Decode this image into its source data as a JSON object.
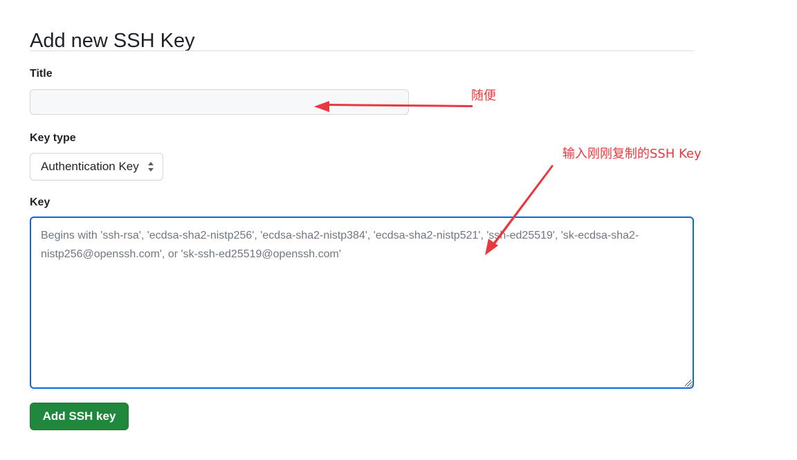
{
  "page": {
    "title": "Add new SSH Key"
  },
  "form": {
    "title_label": "Title",
    "title_value": "",
    "key_type_label": "Key type",
    "key_type_value": "Authentication Key",
    "key_label": "Key",
    "key_placeholder": "Begins with 'ssh-rsa', 'ecdsa-sha2-nistp256', 'ecdsa-sha2-nistp384', 'ecdsa-sha2-nistp521', 'ssh-ed25519', 'sk-ecdsa-sha2-nistp256@openssh.com', or 'sk-ssh-ed25519@openssh.com'",
    "submit_label": "Add SSH key"
  },
  "annotations": {
    "title_note": "随便",
    "key_note": "输入刚刚复制的SSH Key",
    "color": "#e8383d"
  },
  "colors": {
    "primary_button": "#1f883d",
    "focus_border": "#0969da"
  },
  "icons": {
    "select_caret": "up-down-caret-icon",
    "resize": "resize-handle-icon"
  }
}
